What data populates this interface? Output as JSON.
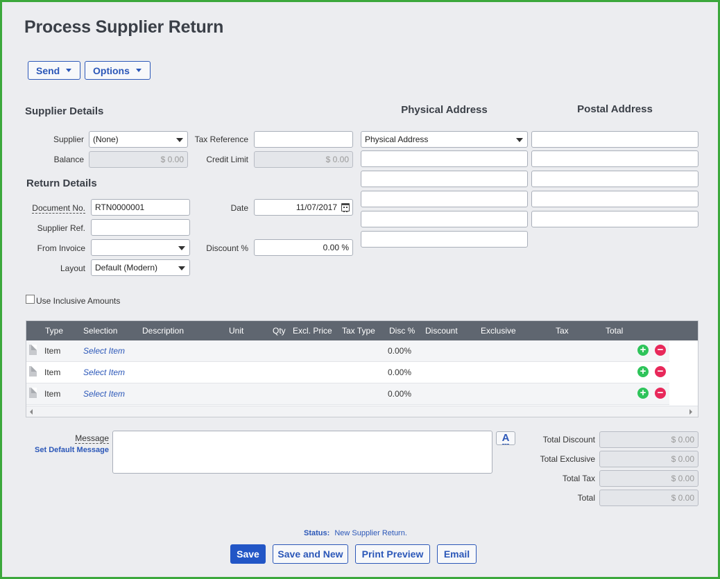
{
  "page": {
    "title": "Process Supplier Return"
  },
  "toolbar": {
    "send_label": "Send",
    "options_label": "Options"
  },
  "supplier_details": {
    "heading": "Supplier Details",
    "supplier_label": "Supplier",
    "supplier_value": "(None)",
    "balance_label": "Balance",
    "balance_value": "$ 0.00",
    "tax_ref_label": "Tax Reference",
    "tax_ref_value": "",
    "credit_limit_label": "Credit Limit",
    "credit_limit_value": "$ 0.00"
  },
  "return_details": {
    "heading": "Return Details",
    "doc_no_label": "Document No.",
    "doc_no_value": "RTN0000001",
    "supplier_ref_label": "Supplier Ref.",
    "supplier_ref_value": "",
    "from_invoice_label": "From Invoice",
    "from_invoice_value": "",
    "layout_label": "Layout",
    "layout_value": "Default (Modern)",
    "date_label": "Date",
    "date_value": "11/07/2017",
    "discount_label": "Discount %",
    "discount_value": "0.00 %"
  },
  "physical_address": {
    "heading": "Physical Address",
    "select_value": "Physical Address"
  },
  "postal_address": {
    "heading": "Postal Address"
  },
  "inclusive": {
    "label": "Use Inclusive Amounts"
  },
  "grid": {
    "columns": [
      "Type",
      "Selection",
      "Description",
      "Unit",
      "Qty",
      "Excl. Price",
      "Tax Type",
      "Disc %",
      "Discount",
      "Exclusive",
      "Tax",
      "Total"
    ],
    "rows": [
      {
        "type": "Item",
        "selection": "Select Item",
        "disc": "0.00%"
      },
      {
        "type": "Item",
        "selection": "Select Item",
        "disc": "0.00%"
      },
      {
        "type": "Item",
        "selection": "Select Item",
        "disc": "0.00%"
      }
    ],
    "add_icon": "plus-circle-icon",
    "remove_icon": "minus-circle-icon"
  },
  "message": {
    "label": "Message",
    "set_default": "Set Default Message",
    "font_button": "A"
  },
  "totals": {
    "discount_label": "Total Discount",
    "discount_value": "$ 0.00",
    "exclusive_label": "Total Exclusive",
    "exclusive_value": "$ 0.00",
    "tax_label": "Total Tax",
    "tax_value": "$ 0.00",
    "total_label": "Total",
    "total_value": "$ 0.00"
  },
  "status": {
    "label": "Status:",
    "value": "New Supplier Return."
  },
  "actions": {
    "save": "Save",
    "save_new": "Save and New",
    "print_preview": "Print Preview",
    "email": "Email"
  },
  "colors": {
    "accent": "#2b57b8",
    "primary": "#2256c6",
    "frame": "#3ca83c",
    "grid_header": "#5f6670",
    "add": "#2ec45a",
    "remove": "#e8285a"
  }
}
